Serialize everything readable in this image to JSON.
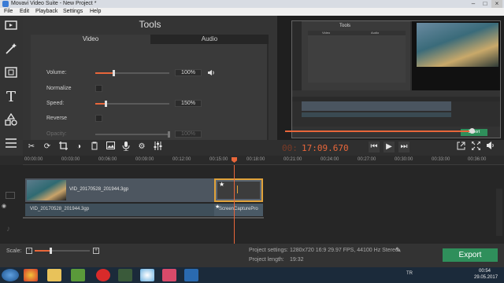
{
  "window": {
    "title": "Movavi Video Suite - New Project *"
  },
  "menu": [
    "File",
    "Edit",
    "Playback",
    "Settings",
    "Help"
  ],
  "tools": {
    "title": "Tools",
    "tabs": [
      "Video",
      "Audio"
    ],
    "props": {
      "volume": {
        "label": "Volume:",
        "value": "100%",
        "level": 0.25
      },
      "normalize": {
        "label": "Normalize"
      },
      "speed": {
        "label": "Speed:",
        "value": "150%",
        "level": 0.15
      },
      "reverse": {
        "label": "Reverse"
      },
      "opacity": {
        "label": "Opacity:",
        "value": "100%",
        "level": 1.0
      }
    }
  },
  "player": {
    "timecode": "17:09.670",
    "timecode_prefix": "00:"
  },
  "ruler": [
    "00:00:00",
    "00:03:00",
    "00:06:00",
    "00:09:00",
    "00:12:00",
    "00:15:00",
    "00:18:00",
    "00:21:00",
    "00:24:00",
    "00:27:00",
    "00:30:00",
    "00:33:00",
    "00:36:00"
  ],
  "timeline": {
    "video_clip": "VID_20170528_201944.3gp",
    "audio_clip": "VID_20170528_201944.3gp",
    "screen_clip": "ScreenCapturePro"
  },
  "bottom": {
    "scale_label": "Scale:",
    "settings_label": "Project settings:",
    "settings_value": "1280x720 16:9 29.97 FPS, 44100 Hz Stereo",
    "length_label": "Project length:",
    "length_value": "19:32",
    "export_label": "Export"
  },
  "taskbar": {
    "lang": "TR",
    "time": "00:54",
    "date": "29.05.2017"
  },
  "preview_inner": {
    "tools_title": "Tools",
    "tabs": [
      "Video",
      "Audio"
    ],
    "export_label": "Export"
  },
  "colors": {
    "accent": "#e8663a",
    "export": "#2f8f5b",
    "clip_selected": "#e0a23a",
    "panel": "#343434"
  }
}
